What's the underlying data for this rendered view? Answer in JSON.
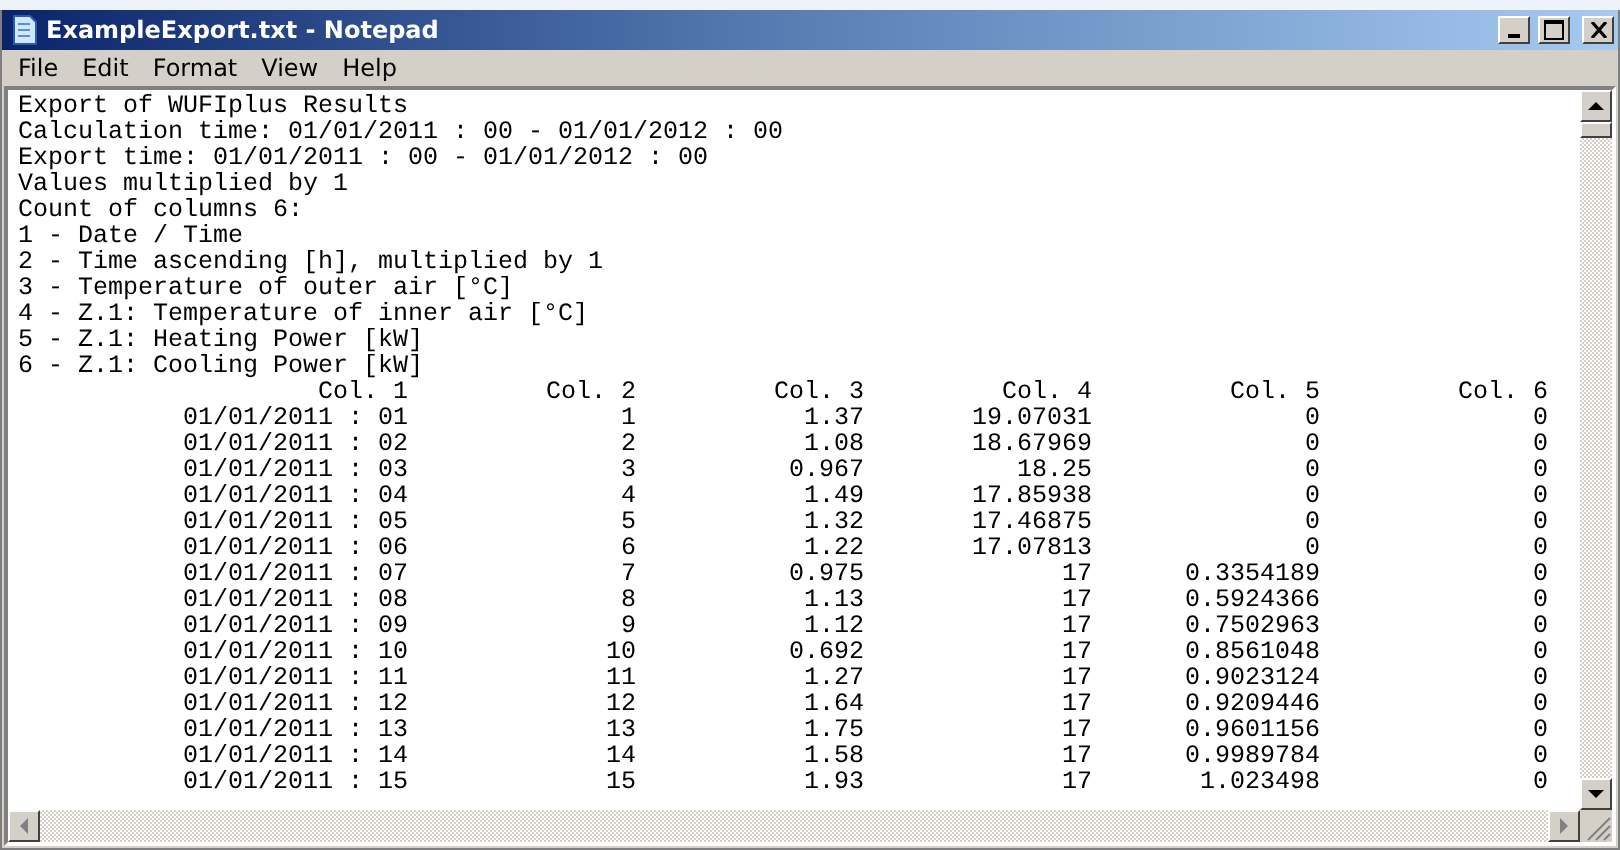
{
  "window": {
    "title": "ExampleExport.txt - Notepad"
  },
  "menu": [
    "File",
    "Edit",
    "Format",
    "View",
    "Help"
  ],
  "document": {
    "lines": [
      "Export of WUFIplus Results",
      "Calculation time: 01/01/2011 : 00 - 01/01/2012 : 00",
      "Export time: 01/01/2011 : 00 - 01/01/2012 : 00",
      "Values multiplied by 1",
      "Count of columns 6:",
      "1 - Date / Time",
      "2 - Time ascending [h], multiplied by 1",
      "3 - Temperature of outer air [°C]",
      "4 - Z.1: Temperature of inner air [°C]",
      "5 - Z.1: Heating Power [kW]",
      "6 - Z.1: Cooling Power [kW]"
    ],
    "table": {
      "columns": [
        "Col. 1",
        "Col. 2",
        "Col. 3",
        "Col. 4",
        "Col. 5",
        "Col. 6"
      ],
      "rows": [
        [
          "01/01/2011 : 01",
          "1",
          "1.37",
          "19.07031",
          "0",
          "0"
        ],
        [
          "01/01/2011 : 02",
          "2",
          "1.08",
          "18.67969",
          "0",
          "0"
        ],
        [
          "01/01/2011 : 03",
          "3",
          "0.967",
          "18.25",
          "0",
          "0"
        ],
        [
          "01/01/2011 : 04",
          "4",
          "1.49",
          "17.85938",
          "0",
          "0"
        ],
        [
          "01/01/2011 : 05",
          "5",
          "1.32",
          "17.46875",
          "0",
          "0"
        ],
        [
          "01/01/2011 : 06",
          "6",
          "1.22",
          "17.07813",
          "0",
          "0"
        ],
        [
          "01/01/2011 : 07",
          "7",
          "0.975",
          "17",
          "0.3354189",
          "0"
        ],
        [
          "01/01/2011 : 08",
          "8",
          "1.13",
          "17",
          "0.5924366",
          "0"
        ],
        [
          "01/01/2011 : 09",
          "9",
          "1.12",
          "17",
          "0.7502963",
          "0"
        ],
        [
          "01/01/2011 : 10",
          "10",
          "0.692",
          "17",
          "0.8561048",
          "0"
        ],
        [
          "01/01/2011 : 11",
          "11",
          "1.27",
          "17",
          "0.9023124",
          "0"
        ],
        [
          "01/01/2011 : 12",
          "12",
          "1.64",
          "17",
          "0.9209446",
          "0"
        ],
        [
          "01/01/2011 : 13",
          "13",
          "1.75",
          "17",
          "0.9601156",
          "0"
        ],
        [
          "01/01/2011 : 14",
          "14",
          "1.58",
          "17",
          "0.9989784",
          "0"
        ],
        [
          "01/01/2011 : 15",
          "15",
          "1.93",
          "17",
          "1.023498",
          "0"
        ]
      ]
    }
  }
}
